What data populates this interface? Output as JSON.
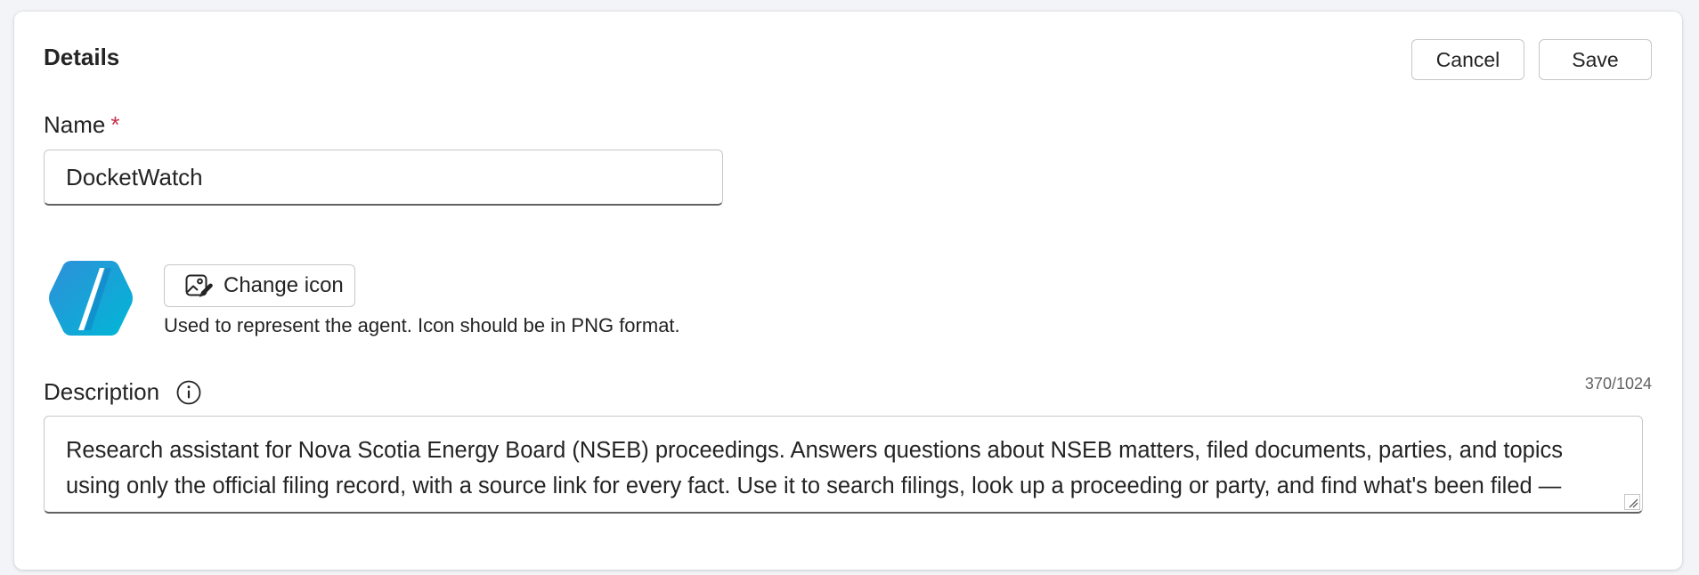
{
  "details": {
    "title": "Details",
    "cancel_label": "Cancel",
    "save_label": "Save"
  },
  "name_field": {
    "label": "Name",
    "required_marker": "*",
    "value": "DocketWatch"
  },
  "icon_section": {
    "logo_icon": "agent-hexagon-logo-icon",
    "change_icon_label": "Change icon",
    "change_icon_icon": "image-edit-icon",
    "hint": "Used to represent the agent. Icon should be in PNG format."
  },
  "description_field": {
    "label": "Description",
    "info_icon": "info-icon",
    "counter": "370/1024",
    "value": "Research assistant for Nova Scotia Energy Board (NSEB) proceedings. Answers questions about NSEB matters, filed documents, parties, and topics using only the official filing record, with a source link for every fact. Use it to search filings, look up a proceeding or party, and find what's been filed — grounded strictly in what's on the public NSEB record."
  },
  "colors": {
    "required": "#c4314b",
    "logo_gradient_start": "#2f8fd8",
    "logo_gradient_end": "#00b7d6"
  }
}
